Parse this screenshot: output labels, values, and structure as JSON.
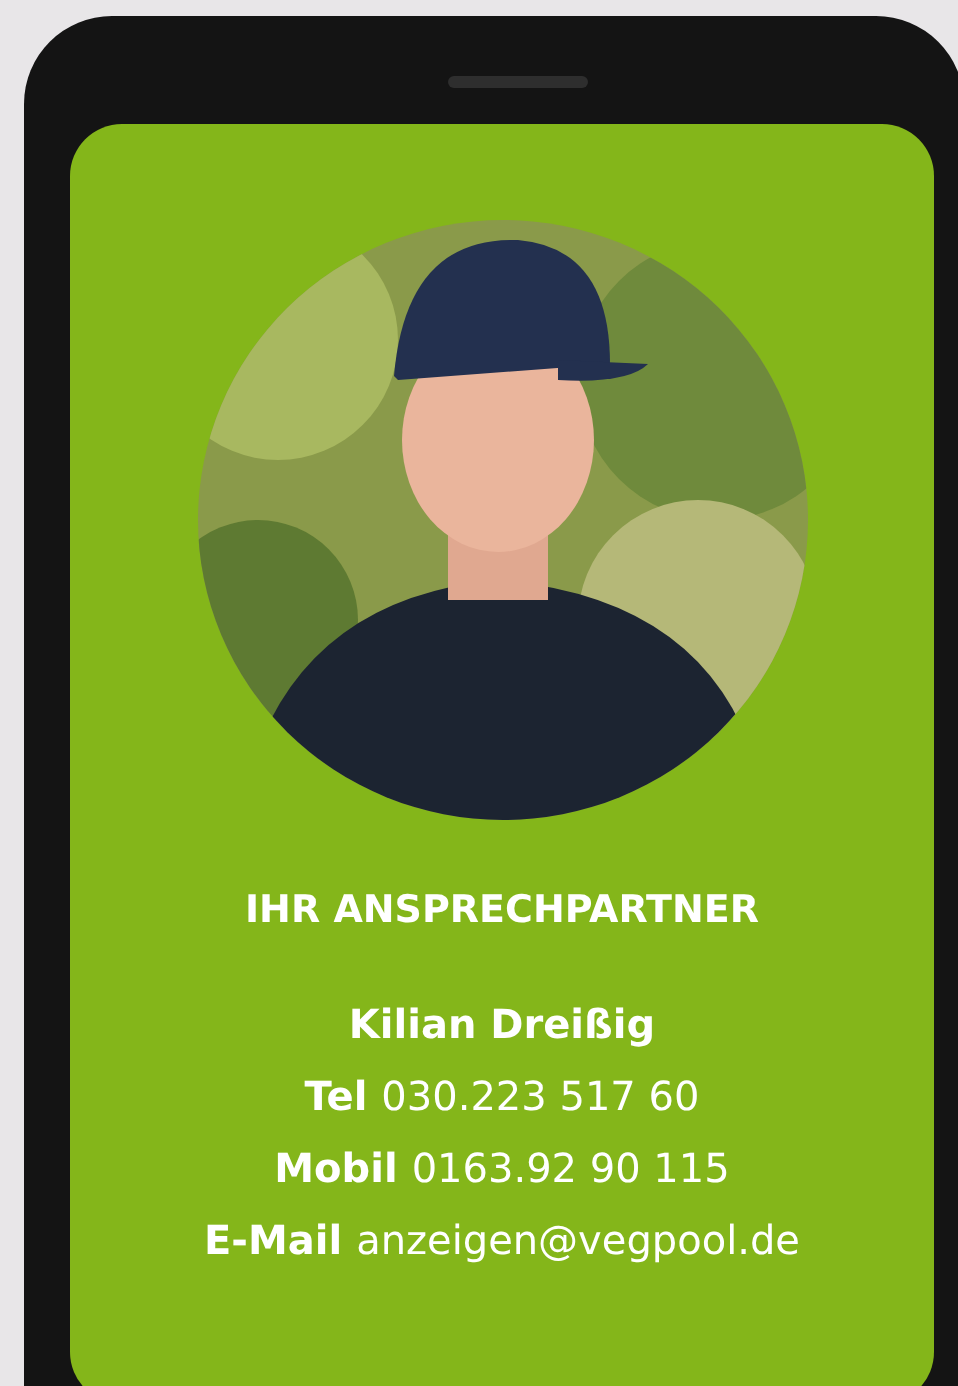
{
  "card": {
    "heading": "IHR ANSPRECHPARTNER",
    "name": "Kilian Dreißig",
    "contacts": [
      {
        "label": "Tel",
        "value": "030.223 517 60"
      },
      {
        "label": "Mobil",
        "value": "0163.92 90 115"
      },
      {
        "label": "E-Mail",
        "value": "anzeigen@vegpool.de"
      }
    ]
  }
}
